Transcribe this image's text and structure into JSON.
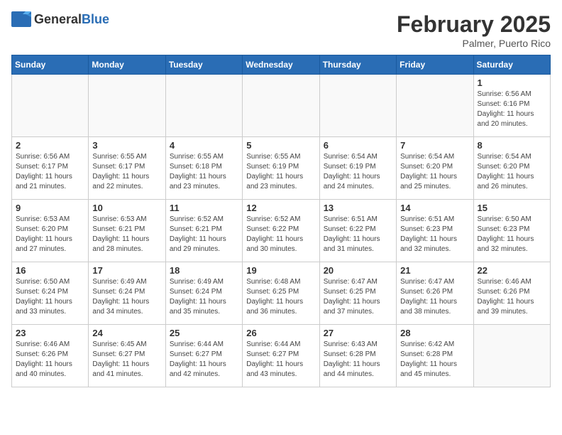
{
  "header": {
    "logo_general": "General",
    "logo_blue": "Blue",
    "month_title": "February 2025",
    "location": "Palmer, Puerto Rico"
  },
  "days_of_week": [
    "Sunday",
    "Monday",
    "Tuesday",
    "Wednesday",
    "Thursday",
    "Friday",
    "Saturday"
  ],
  "weeks": [
    [
      {
        "day": "",
        "info": ""
      },
      {
        "day": "",
        "info": ""
      },
      {
        "day": "",
        "info": ""
      },
      {
        "day": "",
        "info": ""
      },
      {
        "day": "",
        "info": ""
      },
      {
        "day": "",
        "info": ""
      },
      {
        "day": "1",
        "info": "Sunrise: 6:56 AM\nSunset: 6:16 PM\nDaylight: 11 hours\nand 20 minutes."
      }
    ],
    [
      {
        "day": "2",
        "info": "Sunrise: 6:56 AM\nSunset: 6:17 PM\nDaylight: 11 hours\nand 21 minutes."
      },
      {
        "day": "3",
        "info": "Sunrise: 6:55 AM\nSunset: 6:17 PM\nDaylight: 11 hours\nand 22 minutes."
      },
      {
        "day": "4",
        "info": "Sunrise: 6:55 AM\nSunset: 6:18 PM\nDaylight: 11 hours\nand 23 minutes."
      },
      {
        "day": "5",
        "info": "Sunrise: 6:55 AM\nSunset: 6:19 PM\nDaylight: 11 hours\nand 23 minutes."
      },
      {
        "day": "6",
        "info": "Sunrise: 6:54 AM\nSunset: 6:19 PM\nDaylight: 11 hours\nand 24 minutes."
      },
      {
        "day": "7",
        "info": "Sunrise: 6:54 AM\nSunset: 6:20 PM\nDaylight: 11 hours\nand 25 minutes."
      },
      {
        "day": "8",
        "info": "Sunrise: 6:54 AM\nSunset: 6:20 PM\nDaylight: 11 hours\nand 26 minutes."
      }
    ],
    [
      {
        "day": "9",
        "info": "Sunrise: 6:53 AM\nSunset: 6:20 PM\nDaylight: 11 hours\nand 27 minutes."
      },
      {
        "day": "10",
        "info": "Sunrise: 6:53 AM\nSunset: 6:21 PM\nDaylight: 11 hours\nand 28 minutes."
      },
      {
        "day": "11",
        "info": "Sunrise: 6:52 AM\nSunset: 6:21 PM\nDaylight: 11 hours\nand 29 minutes."
      },
      {
        "day": "12",
        "info": "Sunrise: 6:52 AM\nSunset: 6:22 PM\nDaylight: 11 hours\nand 30 minutes."
      },
      {
        "day": "13",
        "info": "Sunrise: 6:51 AM\nSunset: 6:22 PM\nDaylight: 11 hours\nand 31 minutes."
      },
      {
        "day": "14",
        "info": "Sunrise: 6:51 AM\nSunset: 6:23 PM\nDaylight: 11 hours\nand 32 minutes."
      },
      {
        "day": "15",
        "info": "Sunrise: 6:50 AM\nSunset: 6:23 PM\nDaylight: 11 hours\nand 32 minutes."
      }
    ],
    [
      {
        "day": "16",
        "info": "Sunrise: 6:50 AM\nSunset: 6:24 PM\nDaylight: 11 hours\nand 33 minutes."
      },
      {
        "day": "17",
        "info": "Sunrise: 6:49 AM\nSunset: 6:24 PM\nDaylight: 11 hours\nand 34 minutes."
      },
      {
        "day": "18",
        "info": "Sunrise: 6:49 AM\nSunset: 6:24 PM\nDaylight: 11 hours\nand 35 minutes."
      },
      {
        "day": "19",
        "info": "Sunrise: 6:48 AM\nSunset: 6:25 PM\nDaylight: 11 hours\nand 36 minutes."
      },
      {
        "day": "20",
        "info": "Sunrise: 6:47 AM\nSunset: 6:25 PM\nDaylight: 11 hours\nand 37 minutes."
      },
      {
        "day": "21",
        "info": "Sunrise: 6:47 AM\nSunset: 6:26 PM\nDaylight: 11 hours\nand 38 minutes."
      },
      {
        "day": "22",
        "info": "Sunrise: 6:46 AM\nSunset: 6:26 PM\nDaylight: 11 hours\nand 39 minutes."
      }
    ],
    [
      {
        "day": "23",
        "info": "Sunrise: 6:46 AM\nSunset: 6:26 PM\nDaylight: 11 hours\nand 40 minutes."
      },
      {
        "day": "24",
        "info": "Sunrise: 6:45 AM\nSunset: 6:27 PM\nDaylight: 11 hours\nand 41 minutes."
      },
      {
        "day": "25",
        "info": "Sunrise: 6:44 AM\nSunset: 6:27 PM\nDaylight: 11 hours\nand 42 minutes."
      },
      {
        "day": "26",
        "info": "Sunrise: 6:44 AM\nSunset: 6:27 PM\nDaylight: 11 hours\nand 43 minutes."
      },
      {
        "day": "27",
        "info": "Sunrise: 6:43 AM\nSunset: 6:28 PM\nDaylight: 11 hours\nand 44 minutes."
      },
      {
        "day": "28",
        "info": "Sunrise: 6:42 AM\nSunset: 6:28 PM\nDaylight: 11 hours\nand 45 minutes."
      },
      {
        "day": "",
        "info": ""
      }
    ]
  ]
}
